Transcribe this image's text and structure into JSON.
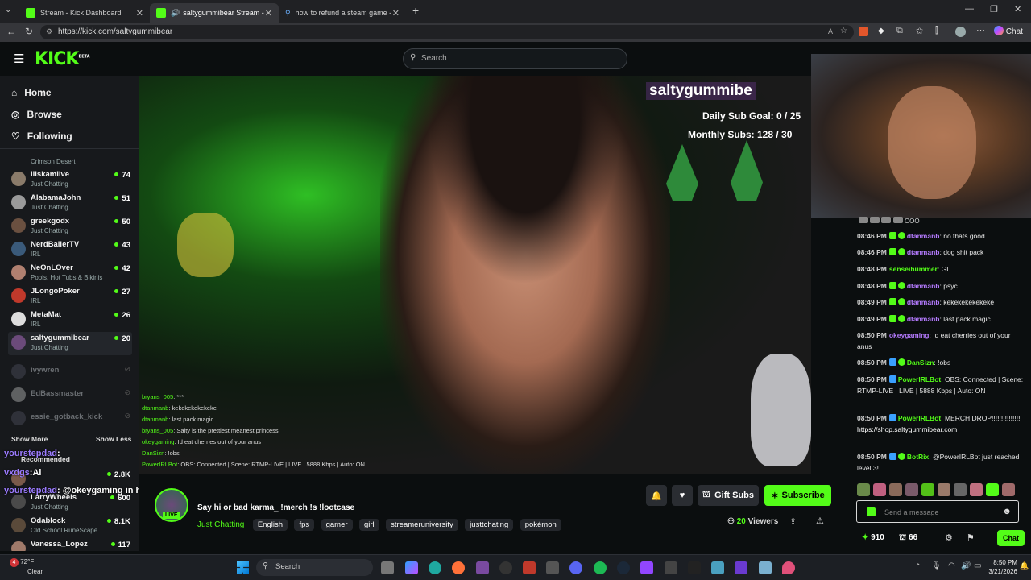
{
  "browser": {
    "tabs": [
      {
        "label": "Stream - Kick Dashboard",
        "active": false
      },
      {
        "label": "saltygummibear Stream - Wa",
        "active": true
      },
      {
        "label": "how to refund a steam game - Sea",
        "active": false
      }
    ],
    "url": "https://kick.com/saltygummibear",
    "chat_button": "Chat"
  },
  "header": {
    "logo": "KICK",
    "logo_badge": "BETA",
    "search_placeholder": "Search"
  },
  "sidebar": {
    "nav": [
      {
        "label": "Home",
        "icon": "home-icon"
      },
      {
        "label": "Browse",
        "icon": "compass-icon"
      },
      {
        "label": "Following",
        "icon": "heart-icon"
      }
    ],
    "partial_top": {
      "name": "",
      "category": "Crimson Desert"
    },
    "channels": [
      {
        "name": "lilskamlive",
        "category": "Just Chatting",
        "viewers": "74"
      },
      {
        "name": "AlabamaJohn",
        "category": "Just Chatting",
        "viewers": "51"
      },
      {
        "name": "greekgodx",
        "category": "Just Chatting",
        "viewers": "50"
      },
      {
        "name": "NerdBallerTV",
        "category": "IRL",
        "viewers": "43"
      },
      {
        "name": "NeOnLOver",
        "category": "Pools, Hot Tubs & Bikinis",
        "viewers": "42"
      },
      {
        "name": "JLongoPoker",
        "category": "IRL",
        "viewers": "27"
      },
      {
        "name": "MetaMat",
        "category": "IRL",
        "viewers": "26"
      },
      {
        "name": "saltygummibear",
        "category": "Just Chatting",
        "viewers": "20"
      }
    ],
    "offline": [
      "ivywren",
      "EdBassmaster",
      "essie_gotback_kick"
    ],
    "show_more": "Show More",
    "show_less": "Show Less",
    "recommended": "Recommended",
    "recommended_channels": [
      {
        "name": "",
        "category": "",
        "viewers": "2.8K"
      },
      {
        "name": "LarryWheels",
        "category": "Just Chatting",
        "viewers": "600"
      },
      {
        "name": "Odablock",
        "category": "Old School RuneScape",
        "viewers": "8.1K"
      },
      {
        "name": "Vanessa_Lopez",
        "category": "",
        "viewers": "117"
      }
    ]
  },
  "stream_overlay": {
    "handle": "saltygummibe",
    "daily_goal": "Daily Sub Goal: 0 / 25",
    "monthly_subs": "Monthly Subs: 128 / 30",
    "chat": [
      {
        "user": "bryans_005",
        "text": "***"
      },
      {
        "user": "dtanmanb",
        "text": "kekekekekekeke"
      },
      {
        "user": "dtanmanb",
        "text": "last pack magic"
      },
      {
        "user": "bryans_005",
        "text": "Salty is the prettiest meanest princess"
      },
      {
        "user": "okeygaming",
        "text": "Id eat cherries out of your anus"
      },
      {
        "user": "DanSizn",
        "text": "!obs"
      },
      {
        "user": "PowerIRLBot",
        "text": "OBS: Connected | Scene: RTMP-LIVE | LIVE | 5888 Kbps | Auto: ON"
      }
    ],
    "overlay_messages": [
      {
        "user": "yourstepdad",
        "text": ":"
      },
      {
        "user": "vxdgs",
        "text": ":Al"
      },
      {
        "user": "yourstepdad",
        "text": ": @okeygaming in her chat coming in hot"
      }
    ]
  },
  "stream_info": {
    "live_badge": "LIVE",
    "title": "Say hi or bad karma_ !merch !s  !lootcase",
    "category": "Just Chatting",
    "tags": [
      "English",
      "fps",
      "gamer",
      "girl",
      "streameruniversity",
      "justtchating",
      "pokémon"
    ],
    "viewers_count": "20",
    "viewers_label": "Viewers",
    "gift_subs": "Gift Subs",
    "subscribe": "Subscribe"
  },
  "chat": {
    "top_fragment": "OOO",
    "messages": [
      {
        "time": "08:46 PM",
        "user": "dtanmanb",
        "color": "#b57bff",
        "badges": 2,
        "text": "no thats good"
      },
      {
        "time": "08:46 PM",
        "user": "dtanmanb",
        "color": "#b57bff",
        "badges": 2,
        "text": "dog shit pack"
      },
      {
        "time": "08:48 PM",
        "user": "senseihummer",
        "color": "#53fc18",
        "badges": 0,
        "text": "GL"
      },
      {
        "time": "08:48 PM",
        "user": "dtanmanb",
        "color": "#b57bff",
        "badges": 2,
        "text": "psyc"
      },
      {
        "time": "08:49 PM",
        "user": "dtanmanb",
        "color": "#b57bff",
        "badges": 2,
        "text": "kekekekekekeke"
      },
      {
        "time": "08:49 PM",
        "user": "dtanmanb",
        "color": "#b57bff",
        "badges": 2,
        "text": "last pack magic"
      },
      {
        "time": "08:50 PM",
        "user": "okeygaming",
        "color": "#b57bff",
        "badges": 0,
        "text": "Id eat cherries out of your anus"
      },
      {
        "time": "08:50 PM",
        "user": "DanSizn",
        "color": "#53fc18",
        "badges": 2,
        "text": "!obs"
      },
      {
        "time": "08:50 PM",
        "user": "PowerIRLBot",
        "color": "#53fc18",
        "badges": 1,
        "text": "OBS: Connected | Scene: RTMP-LIVE | LIVE | 5888 Kbps | Auto: ON"
      },
      {
        "time": "08:50 PM",
        "user": "PowerIRLBot",
        "color": "#53fc18",
        "badges": 1,
        "text": "MERCH DROP!!!!!!!!!!!!!!!"
      },
      {
        "time": "08:50 PM",
        "user": "BotRix",
        "color": "#53fc18",
        "badges": 2,
        "text": "@PowerIRLBot just reached level 3!"
      }
    ],
    "merch_link": "https://shop.saltygummibear.com",
    "input_placeholder": "Send a message",
    "points": "910",
    "gifts": "66",
    "send_label": "Chat"
  },
  "taskbar": {
    "weather_temp": "72°F",
    "weather_desc": "Clear",
    "search_label": "Search",
    "time": "8:50 PM",
    "date": "3/21/2026",
    "notification_badge": "4"
  },
  "colors": {
    "kick_green": "#53fc18",
    "background": "#0b0e0f",
    "sidebar_bg": "#17191c",
    "username_purple": "#b57bff"
  }
}
